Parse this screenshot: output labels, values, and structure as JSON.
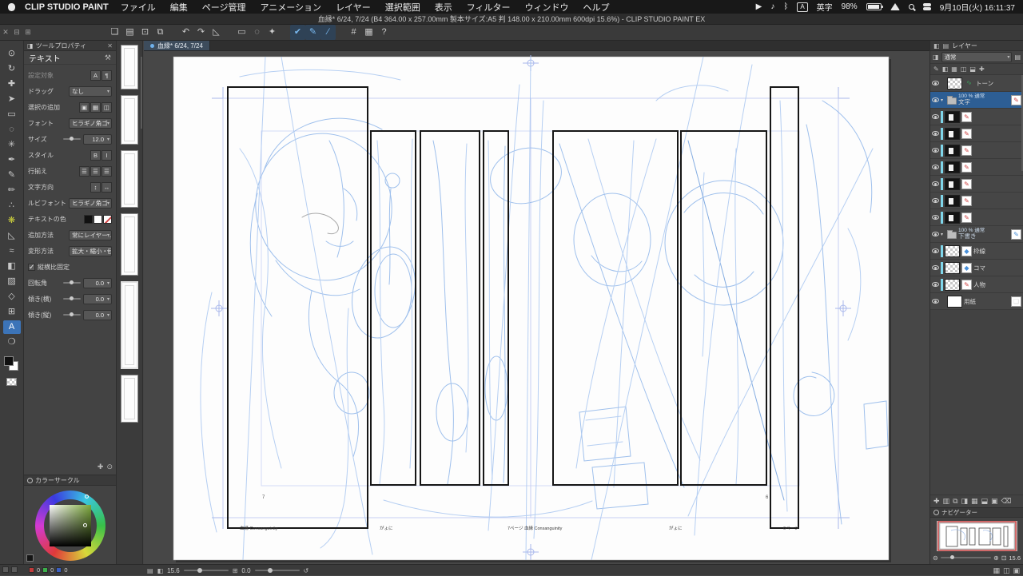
{
  "menu_bar": {
    "app_name": "CLIP STUDIO PAINT",
    "items": [
      "ファイル",
      "編集",
      "ページ管理",
      "アニメーション",
      "レイヤー",
      "選択範囲",
      "表示",
      "フィルター",
      "ウィンドウ",
      "ヘルプ"
    ],
    "status": {
      "play_glyph": "▶",
      "volume_glyph": "♪",
      "bluetooth_glyph": "ᛒ",
      "ime_badge": "A",
      "ime_mode": "英字",
      "battery_percent": "98%",
      "datetime": "9月10日(火) 16:11:37"
    }
  },
  "title_bar": {
    "title": "血縁* 6/24, 7/24 (B4 364.00 x 257.00mm 製本サイズ:A5 判 148.00 x 210.00mm 600dpi 15.6%)  - CLIP STUDIO PAINT EX"
  },
  "toolbar": {
    "window_buttons": [
      "✕",
      "⊟",
      "⊞"
    ],
    "buttons": [
      {
        "name": "new",
        "glyph": "❏"
      },
      {
        "name": "open",
        "glyph": "▤"
      },
      {
        "name": "save",
        "glyph": "⊡"
      },
      {
        "name": "print",
        "glyph": "⧉"
      },
      {
        "name": "undo",
        "glyph": "↶"
      },
      {
        "name": "redo",
        "glyph": "↷"
      },
      {
        "name": "clear",
        "glyph": "◺"
      },
      {
        "name": "select-rect",
        "glyph": "▭"
      },
      {
        "name": "select-lasso",
        "glyph": "◌"
      },
      {
        "name": "select-invert",
        "glyph": "✦"
      },
      {
        "name": "snap-on",
        "glyph": "✔",
        "active": true
      },
      {
        "name": "snap-pen",
        "glyph": "✎",
        "active": true
      },
      {
        "name": "snap-ruler",
        "glyph": "∕",
        "active": true
      },
      {
        "name": "grid",
        "glyph": "#"
      },
      {
        "name": "material",
        "glyph": "▦"
      },
      {
        "name": "help",
        "glyph": "?"
      }
    ]
  },
  "toolbox": {
    "tools": [
      {
        "name": "zoom",
        "glyph": "⊙"
      },
      {
        "name": "rotate-canvas",
        "glyph": "↻"
      },
      {
        "name": "move",
        "glyph": "✚"
      },
      {
        "name": "operate",
        "glyph": "➤"
      },
      {
        "name": "select-area",
        "glyph": "▭"
      },
      {
        "name": "lasso",
        "glyph": "◌"
      },
      {
        "name": "magic-wand",
        "glyph": "✳"
      },
      {
        "name": "pen",
        "glyph": "✒"
      },
      {
        "name": "pencil",
        "glyph": "✎"
      },
      {
        "name": "brush",
        "glyph": "✏"
      },
      {
        "name": "airbrush",
        "glyph": "∴"
      },
      {
        "name": "decoration",
        "glyph": "❋"
      },
      {
        "name": "eraser",
        "glyph": "◺"
      },
      {
        "name": "blend",
        "glyph": "≈"
      },
      {
        "name": "fill",
        "glyph": "◧"
      },
      {
        "name": "gradient",
        "glyph": "▨"
      },
      {
        "name": "figure",
        "glyph": "◇"
      },
      {
        "name": "frame",
        "glyph": "⊞"
      },
      {
        "name": "text",
        "glyph": "A"
      },
      {
        "name": "balloon",
        "glyph": "❍"
      }
    ]
  },
  "tool_property": {
    "panel_title": "ツールプロパティ",
    "tool_name": "テキスト",
    "fields": {
      "target_label": "設定対象",
      "drag_label": "ドラッグ",
      "drag_value": "なし",
      "selection_add_label": "選択の追加",
      "font_label": "フォント",
      "font_value": "ヒラギノ角ゴ",
      "size_label": "サイズ",
      "size_value": "12.0",
      "style_label": "スタイル",
      "align_label": "行揃え",
      "direction_label": "文字方向",
      "ruby_font_label": "ルビフォント",
      "ruby_font_value": "ヒラギノ角ゴ",
      "text_color_label": "テキストの色",
      "add_method_label": "追加方法",
      "add_method_value": "常にレイヤー…",
      "transform_label": "変形方法",
      "transform_value": "拡大・縮小・回…",
      "aspect_lock_label": "縦横比固定",
      "rotation_label": "回転角",
      "rotation_value": "0.0",
      "skew_h_label": "傾き(横)",
      "skew_h_value": "0.0",
      "skew_v_label": "傾き(縦)",
      "skew_v_value": "0.0"
    },
    "icon_sets": {
      "target": [
        "A",
        "¶"
      ],
      "selection_add": [
        "▣",
        "▦",
        "◫"
      ],
      "style": [
        "B",
        "I"
      ],
      "align": [
        "☰",
        "☰",
        "☰"
      ],
      "direction": [
        "↕",
        "↔"
      ]
    }
  },
  "color_panel": {
    "title": "カラーサークル",
    "r": "0",
    "g": "0",
    "b": "0"
  },
  "document_tab": {
    "label": "血縁* 6/24, 7/24"
  },
  "canvas": {
    "footer_left": "血縁 Consanguinity",
    "footer_left_mid": "がょに",
    "footer_center": "7ページ 血縁 Consanguinity",
    "footer_right_mid": "がょに",
    "footer_right": "6ページ",
    "page_number_left": "7",
    "page_number_right": "6"
  },
  "layers_panel": {
    "title": "レイヤー",
    "blend_mode": "通常",
    "items": [
      {
        "name": "トーン",
        "info": ""
      },
      {
        "name": "文字",
        "info": "100 % 通常"
      },
      {
        "name": "",
        "info": ""
      },
      {
        "name": "",
        "info": ""
      },
      {
        "name": "",
        "info": ""
      },
      {
        "name": "",
        "info": ""
      },
      {
        "name": "",
        "info": ""
      },
      {
        "name": "",
        "info": ""
      },
      {
        "name": "",
        "info": ""
      },
      {
        "name": "下書き",
        "info": "100 % 通常"
      },
      {
        "name": "枠線",
        "info": ""
      },
      {
        "name": "コマ",
        "info": ""
      },
      {
        "name": "人物",
        "info": ""
      },
      {
        "name": "用紙",
        "info": ""
      }
    ]
  },
  "navigator": {
    "title": "ナビゲーター",
    "zoom_value": "15.6"
  },
  "status_bar": {
    "zoom_value": "15.6",
    "rotation_value": "0.0"
  }
}
